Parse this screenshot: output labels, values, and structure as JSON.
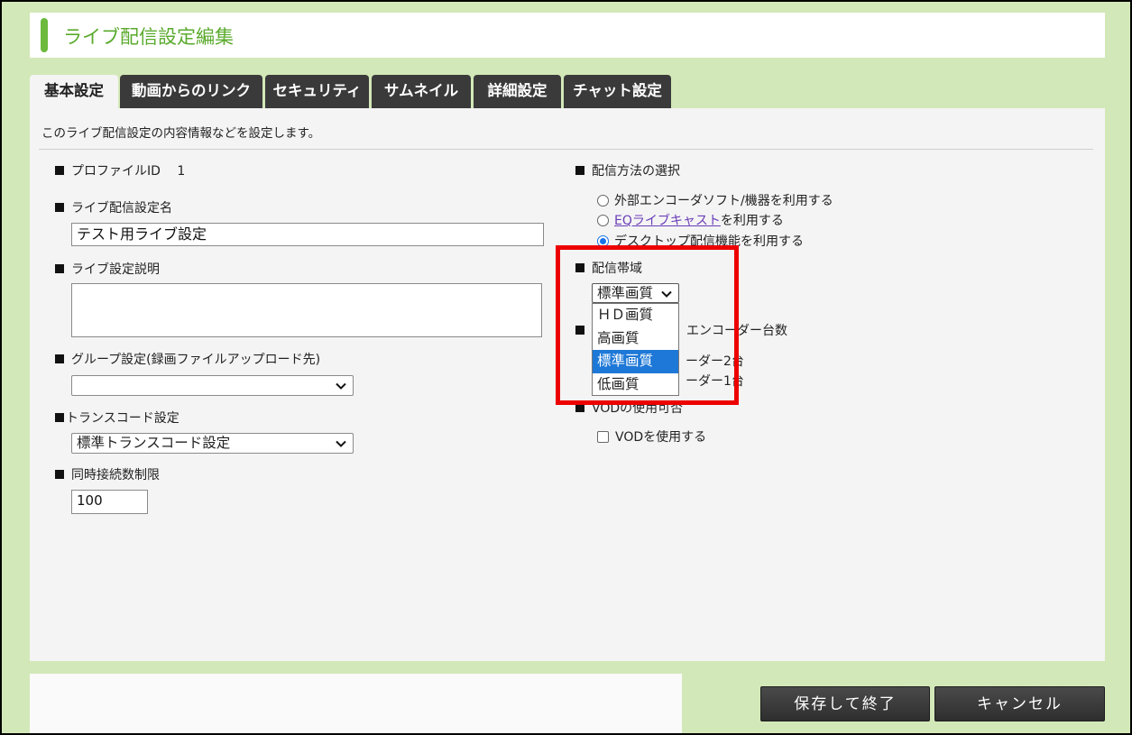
{
  "title": "ライブ配信設定編集",
  "tabs": [
    "基本設定",
    "動画からのリンク",
    "セキュリティ",
    "サムネイル",
    "詳細設定",
    "チャット設定"
  ],
  "description": "このライブ配信設定の内容情報などを設定します。",
  "left": {
    "profile_label": "プロファイルID",
    "profile_id": "1",
    "name_label": "ライブ配信設定名",
    "name_value": "テスト用ライブ設定",
    "desc_label": "ライブ設定説明",
    "group_label": "グループ設定(録画ファイルアップロード先)",
    "group_value": "",
    "transcode_label": "トランスコード設定",
    "transcode_value": "標準トランスコード設定",
    "limit_label": "同時接続数制限",
    "limit_value": "100"
  },
  "right": {
    "method_label": "配信方法の選択",
    "method_options": [
      {
        "text": "外部エンコーダソフト/機器を利用する",
        "checked": false
      },
      {
        "link": "EQライブキャスト",
        "text": "を利用する",
        "checked": false
      },
      {
        "text": "デスクトップ配信機能を利用する",
        "checked": true
      }
    ],
    "band_label": "配信帯域",
    "band_value": "標準画質",
    "band_options": [
      "ＨＤ画質",
      "高画質",
      "標準画質",
      "低画質"
    ],
    "band_selected_index": 2,
    "encoder_label_partial": "エンコーダー台数",
    "encoder_opt1_partial": "ーダー2台",
    "encoder_opt2_partial": "ーダー1台",
    "vod_label_partial": "VODの使用可否",
    "vod_checkbox_label": "VODを使用する"
  },
  "buttons": {
    "save": "保存して終了",
    "cancel": "キャンセル"
  },
  "colors": {
    "background": "#d3e8b8",
    "accent_green": "#6cb93e",
    "tab_dark": "#3a3a3a",
    "highlight_red": "#ec0000",
    "selected_blue": "#1e78d7"
  }
}
